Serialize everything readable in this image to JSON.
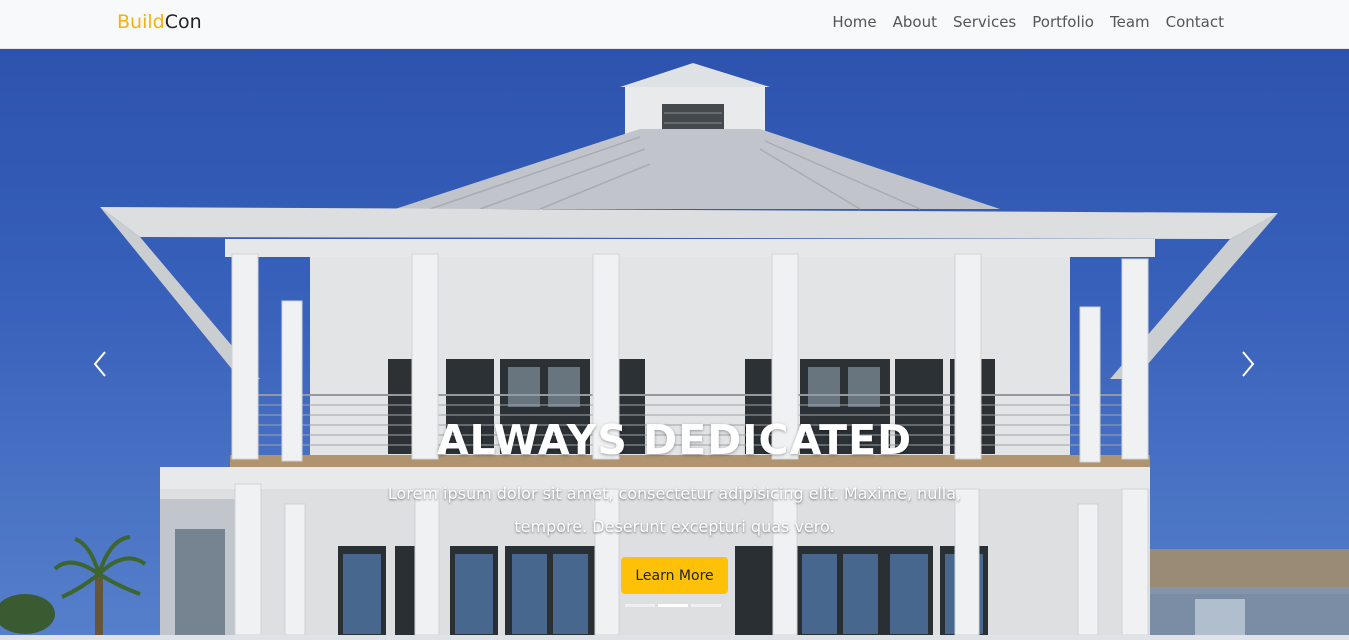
{
  "brand": {
    "part1": "Build",
    "part2": "Con",
    "accent_color": "#f5b30a"
  },
  "nav": {
    "items": [
      {
        "label": "Home"
      },
      {
        "label": "About"
      },
      {
        "label": "Services"
      },
      {
        "label": "Portfolio"
      },
      {
        "label": "Team"
      },
      {
        "label": "Contact"
      }
    ]
  },
  "hero": {
    "title": "ALWAYS DEDICATED",
    "text": "Lorem ipsum dolor sit amet, consectetur adipisicing elit. Maxime, nulla, tempore. Deserunt excepturi quas vero.",
    "button_label": "Learn More",
    "button_color": "#ffc107",
    "prev_icon": "chevron-left-icon",
    "next_icon": "chevron-right-icon",
    "slides_count": 3,
    "active_slide": 2
  }
}
